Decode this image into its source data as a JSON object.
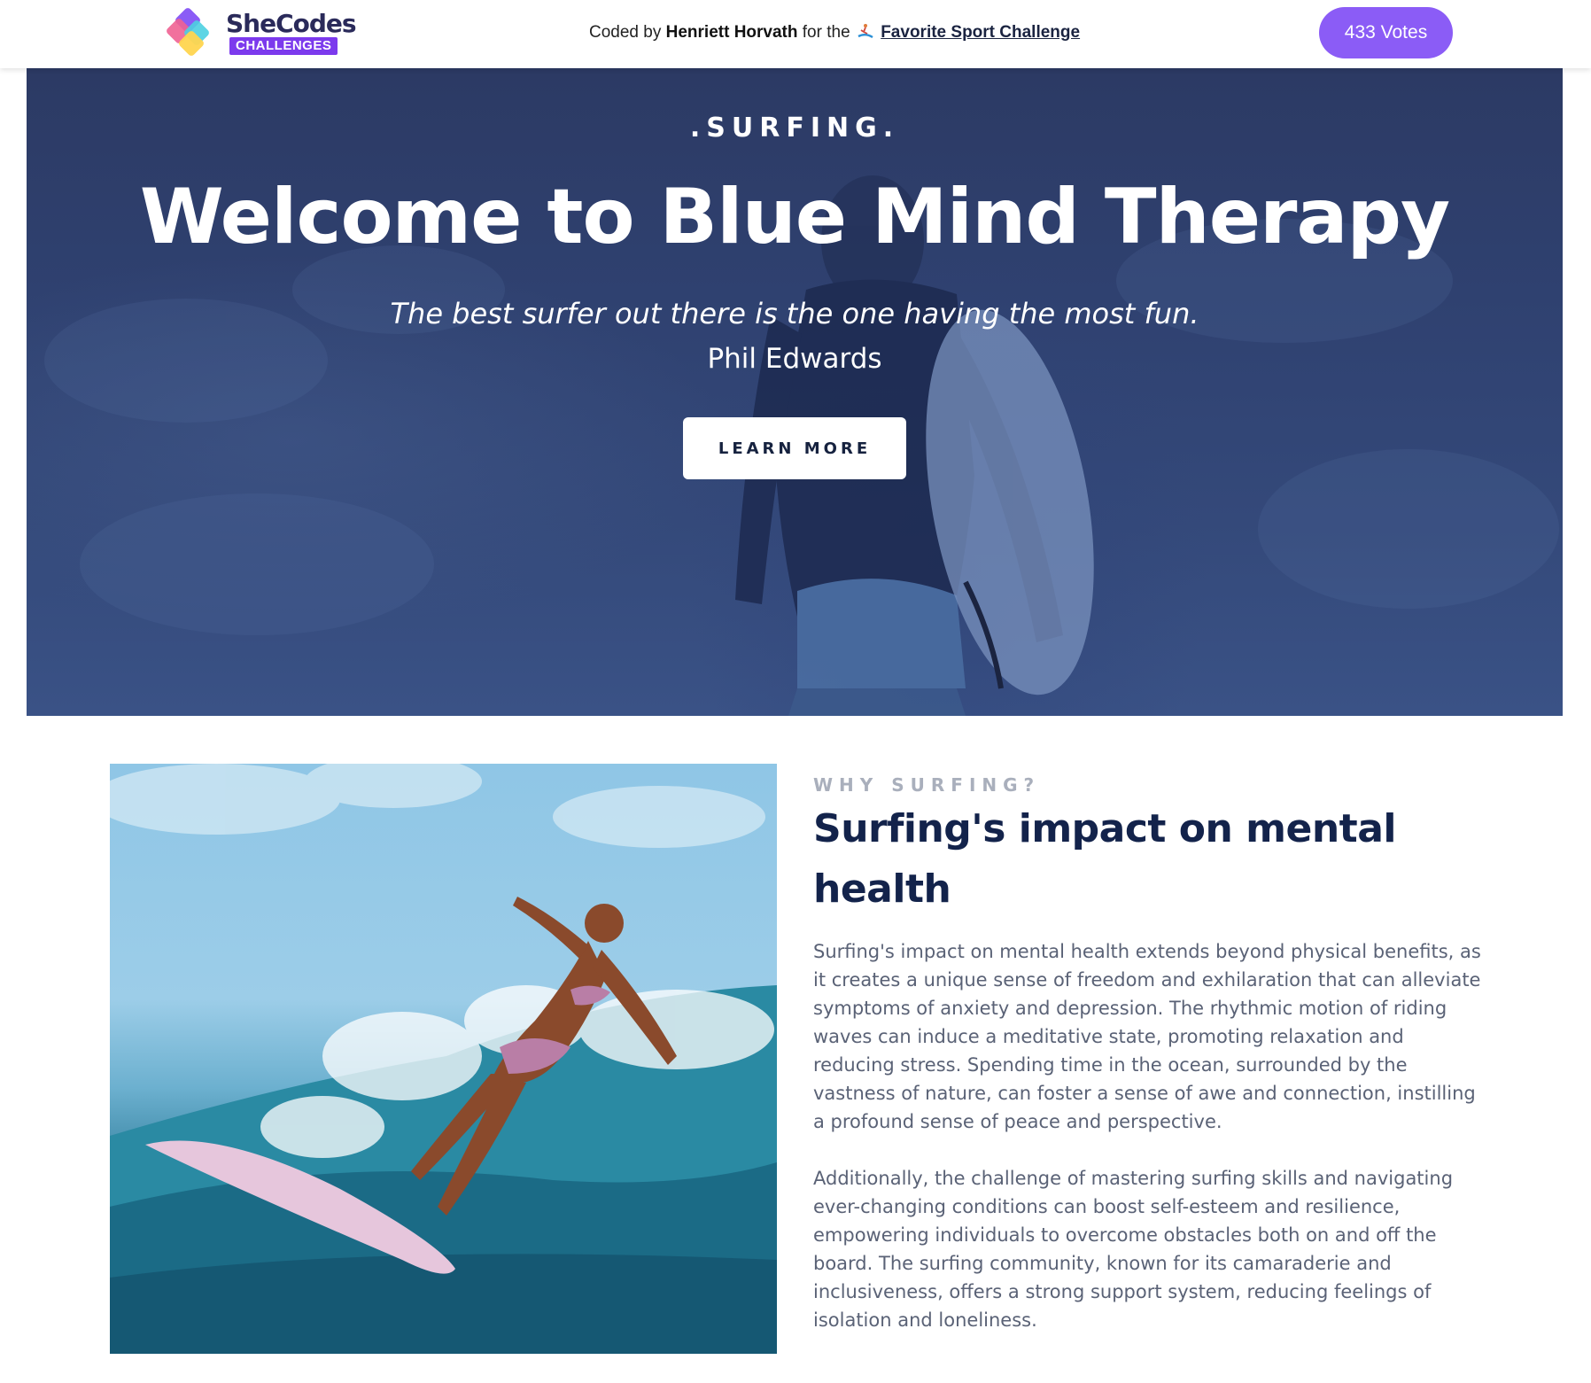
{
  "topbar": {
    "logo": {
      "name": "SheCodes",
      "badge": "CHALLENGES"
    },
    "credit": {
      "prefix": "Coded by",
      "author": "Henriett Horvath",
      "middle": "for the",
      "challenge": "Favorite Sport Challenge"
    },
    "votes_label": "433 Votes"
  },
  "hero": {
    "eyebrow": ".SURFING.",
    "title": "Welcome to Blue Mind Therapy",
    "quote": "The best surfer out there is the one having the most fun.",
    "author": "Phil Edwards",
    "button_label": "LEARN MORE"
  },
  "section": {
    "kicker": "WHY SURFING?",
    "title": "Surfing's impact on mental health",
    "paragraphs": [
      "Surfing's impact on mental health extends beyond physical benefits, as it creates a unique sense of freedom and exhilaration that can alleviate symptoms of anxiety and depression. The rhythmic motion of riding waves can induce a meditative state, promoting relaxation and reducing stress. Spending time in the ocean, surrounded by the vastness of nature, can foster a sense of awe and connection, instilling a profound sense of peace and perspective.",
      "Additionally, the challenge of mastering surfing skills and navigating ever-changing conditions can boost self-esteem and resilience, empowering individuals to overcome obstacles both on and off the board. The surfing community, known for its camaraderie and inclusiveness, offers a strong support system, reducing feelings of isolation and loneliness."
    ]
  },
  "colors": {
    "accent": "#8b5cf6",
    "badge": "#7c3aed",
    "hero_bg": "#2f4170",
    "heading": "#13234b",
    "body_text": "#5a6276"
  }
}
